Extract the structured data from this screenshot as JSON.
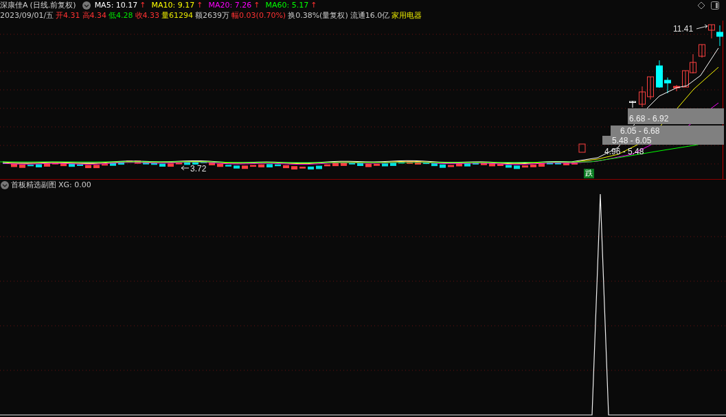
{
  "header": {
    "name": "深康佳A",
    "period": "(日线.前复权)"
  },
  "ma": [
    {
      "label": "MA5: 10.17",
      "arrow": "↑",
      "color": "#ffffff"
    },
    {
      "label": "MA10: 9.17",
      "arrow": "↑",
      "color": "#ffff00"
    },
    {
      "label": "MA20: 7.26",
      "arrow": "↑",
      "color": "#ff00ff"
    },
    {
      "label": "MA60: 5.17",
      "arrow": "↑",
      "color": "#00ff00"
    }
  ],
  "quote": [
    {
      "text": "2023/09/01/五",
      "kind": "neutral"
    },
    {
      "text": "开4.31",
      "kind": "up"
    },
    {
      "text": "高4.34",
      "kind": "up"
    },
    {
      "text": "低4.28",
      "kind": "down"
    },
    {
      "text": "收4.33",
      "kind": "up"
    },
    {
      "text": "量61294",
      "kind": "volume"
    },
    {
      "text": "额2639万",
      "kind": "neutral"
    },
    {
      "text": "幅0.03(0.70%)",
      "kind": "up"
    },
    {
      "text": "换0.38%(量复权)",
      "kind": "neutral"
    },
    {
      "text": "流通16.0亿",
      "kind": "neutral"
    },
    {
      "text": "家用电器",
      "kind": "sector"
    }
  ],
  "main_chart": {
    "high_label": "11.41",
    "low_label": "3.72",
    "zones": [
      "6.68 - 6.92",
      "6.05 - 6.68",
      "5.48 - 6.05",
      "4.96 - 5.48"
    ],
    "signal": "跌"
  },
  "sub_chart": {
    "title": "首板精选副图",
    "reading": "XG: 0.00"
  }
}
